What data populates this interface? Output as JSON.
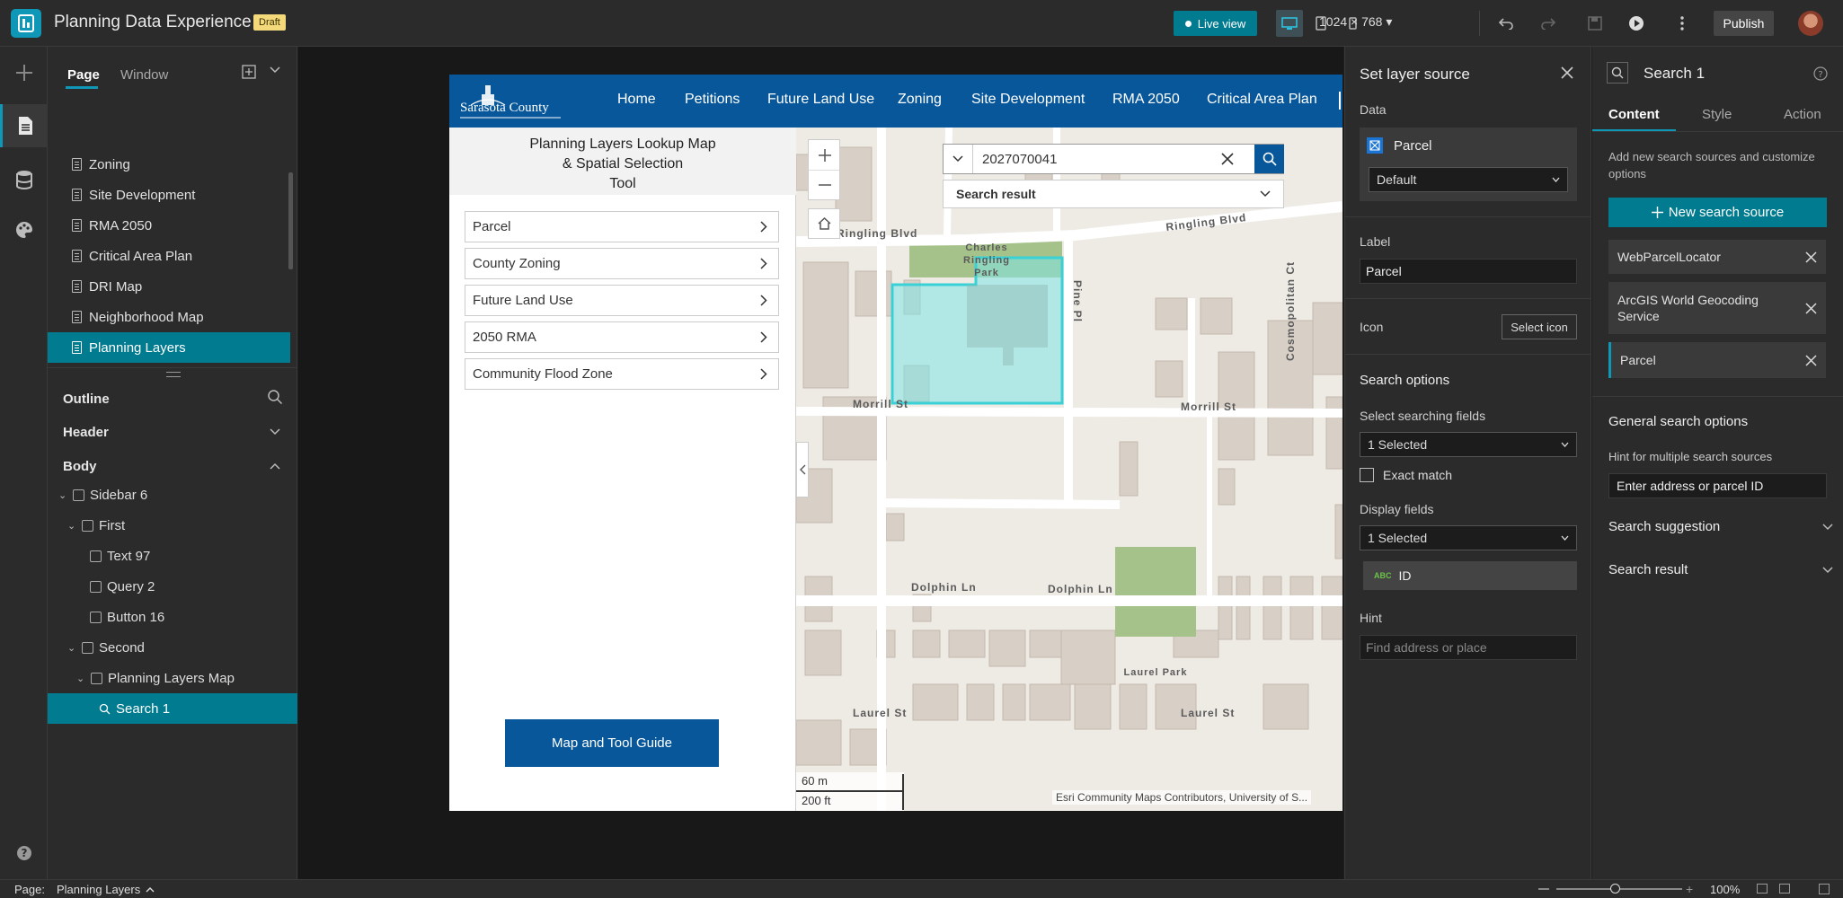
{
  "app": {
    "title": "Planning Data Experience",
    "badge": "Draft"
  },
  "toolbar": {
    "live_view": "Live view",
    "resolution": "1024 × 768",
    "publish": "Publish"
  },
  "left_panel": {
    "tabs": [
      "Page",
      "Window"
    ],
    "pages": [
      "Zoning",
      "Site Development",
      "RMA 2050",
      "Critical Area Plan",
      "DRI Map",
      "Neighborhood Map",
      "Planning Layers"
    ],
    "outline_title": "Outline",
    "header": "Header",
    "body": "Body",
    "tree": [
      "Sidebar 6",
      "First",
      "Text 97",
      "Query 2",
      "Button 16",
      "Second",
      "Planning Layers Map",
      "Search 1"
    ]
  },
  "site": {
    "logo_text": "Sarasota County",
    "nav": [
      "Home",
      "Petitions",
      "Future Land Use",
      "Zoning",
      "Site Development",
      "RMA 2050",
      "Critical Area Plan"
    ],
    "sidebar_title_lines": [
      "Planning Layers Lookup Map",
      "& Spatial Selection",
      "Tool"
    ],
    "accordion": [
      "Parcel",
      "County Zoning",
      "Future Land Use",
      "2050 RMA",
      "Community Flood Zone"
    ],
    "guide_button": "Map and Tool Guide"
  },
  "map": {
    "search_value": "2027070041",
    "search_result": "Search result",
    "streets": [
      "Ringling Blvd",
      "Ringling Blvd",
      "Morrill St",
      "Morrill St",
      "Dolphin Ln",
      "Dolphin Ln",
      "Laurel St",
      "Laurel St",
      "Pine Pl",
      "Cosmopolitan Ct"
    ],
    "parks": [
      "Charles",
      "Ringling",
      "Park",
      "Laurel Park"
    ],
    "scale": [
      "60 m",
      "200 ft"
    ],
    "attribution": "Esri Community Maps Contributors, University of S..."
  },
  "layer_source": {
    "title": "Set layer source",
    "data_label": "Data",
    "data_source": "Parcel",
    "view": "Default",
    "label_label": "Label",
    "label_value": "Parcel",
    "icon_label": "Icon",
    "select_icon": "Select icon",
    "search_options": "Search options",
    "searching_fields_label": "Select searching fields",
    "searching_fields_value": "1 Selected",
    "exact_match": "Exact match",
    "display_fields_label": "Display fields",
    "display_fields_value": "1 Selected",
    "field_type": "ABC",
    "field_name": "ID",
    "hint_label": "Hint",
    "hint_placeholder": "Find address or place"
  },
  "search_panel": {
    "title": "Search 1",
    "tabs": [
      "Content",
      "Style",
      "Action"
    ],
    "description": "Add new search sources and customize options",
    "new_source": "New search source",
    "sources": [
      "WebParcelLocator",
      "ArcGIS World Geocoding Service",
      "Parcel"
    ],
    "general_options": "General search options",
    "hint_label": "Hint for multiple search sources",
    "hint_value": "Enter address or parcel ID",
    "search_suggestion": "Search suggestion",
    "search_result": "Search result"
  },
  "status": {
    "page_label": "Page:",
    "page_value": "Planning Layers",
    "zoom": "100%"
  },
  "colors": {
    "accent": "#007b8f",
    "site_blue": "#07579a",
    "selection": "#7fe5e5"
  }
}
